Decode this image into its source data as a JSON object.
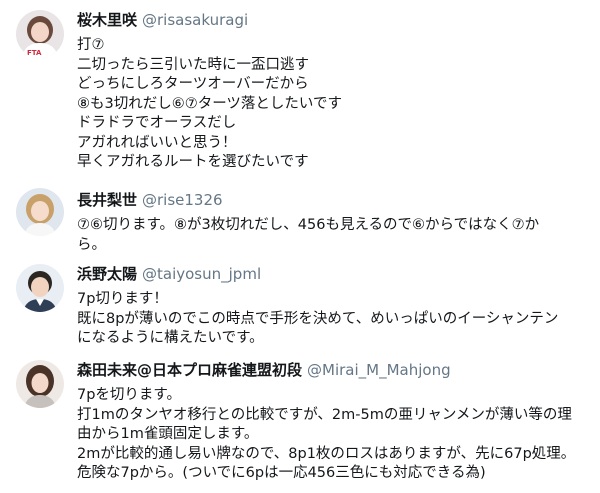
{
  "tweets": [
    {
      "name": "桜木里咲",
      "handle": "@risasakuragi",
      "avatar_icon": "user-avatar-icon",
      "lines": [
        "打⑦",
        "二切ったら三引いた時に一盃口逃す",
        "どっちにしろターツオーバーだから",
        "⑧も3切れだし⑥⑦ターツ落としたいです",
        "ドラドラでオーラスだし",
        "アガれればいいと思う！",
        "早くアガれるルートを選びたいです"
      ]
    },
    {
      "name": "長井梨世",
      "handle": "@rise1326",
      "avatar_icon": "user-avatar-icon",
      "lines": [
        "⑦⑥切ります。⑧が3枚切れだし、456も見えるので⑥からではなく⑦か",
        "ら。"
      ]
    },
    {
      "name": "浜野太陽",
      "handle": "@taiyosun_jpml",
      "avatar_icon": "user-avatar-icon",
      "lines": [
        "7p切ります！",
        "既に8pが薄いのでこの時点で手形を決めて、めいっぱいのイーシャンテン",
        "になるように構えたいです。"
      ]
    },
    {
      "name": "森田未来@日本プロ麻雀連盟初段",
      "handle": "@Mirai_M_Mahjong",
      "avatar_icon": "user-avatar-icon",
      "lines": [
        "7pを切ります。",
        "打1mのタンヤオ移行との比較ですが、2m-5mの亜リャンメンが薄い等の理",
        "由から1m雀頭固定します。",
        "2mが比較的通し易い牌なので、8p1枚のロスはありますが、先に67p処理。",
        "危険な7pから。(ついでに6pは一応456三色にも対応できる為)"
      ]
    }
  ]
}
